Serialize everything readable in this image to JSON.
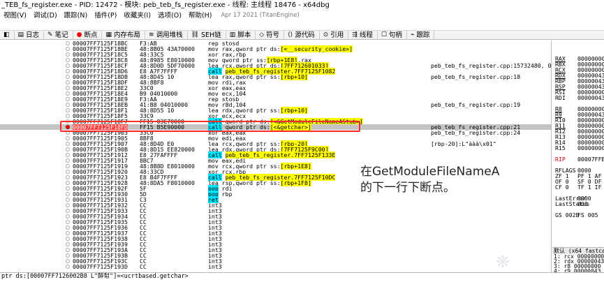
{
  "title": {
    "text": "_TEB_fs_register.exe - PID: 12472 - 模块: peb_teb_fs_register.exe - 线程: 主线程 18476 - x64dbg"
  },
  "menu": {
    "items": [
      "视图(V)",
      "调试(D)",
      "跟踪(N)",
      "插件(P)",
      "收藏夹(I)",
      "选项(O)",
      "帮助(H)"
    ],
    "date_info": "Apr 17 2021 (TitanEngine)"
  },
  "tabs": [
    {
      "label": "日志",
      "icon": "log-icon"
    },
    {
      "label": "笔记",
      "icon": "notes-icon"
    },
    {
      "label": "断点",
      "icon": "breakpoint-icon"
    },
    {
      "label": "内存布局",
      "icon": "memory-map-icon"
    },
    {
      "label": "调用堆栈",
      "icon": "call-stack-icon"
    },
    {
      "label": "SEH链",
      "icon": "seh-chain-icon"
    },
    {
      "label": "脚本",
      "icon": "script-icon"
    },
    {
      "label": "符号",
      "icon": "symbols-icon"
    },
    {
      "label": "源代码",
      "icon": "source-icon"
    },
    {
      "label": "引用",
      "icon": "references-icon"
    },
    {
      "label": "线程",
      "icon": "threads-icon"
    },
    {
      "label": "句柄",
      "icon": "handles-icon"
    },
    {
      "label": "跟踪",
      "icon": "trace-icon"
    }
  ],
  "disasm": {
    "rows": [
      {
        "addr": "00007FF7125F18BC",
        "bytes": "F3:AB",
        "instr": "rep stosd",
        "cmt": ""
      },
      {
        "addr": "00007FF7125F18BE",
        "bytes": "48:8B05 43A70000",
        "instr": "mov rax,qword ptr ds:[<__security_cookie>]",
        "cmt": ""
      },
      {
        "addr": "00007FF7125F18C5",
        "bytes": "48:33C5",
        "instr": "xor rax,rbp",
        "cmt": ""
      },
      {
        "addr": "00007FF7125F18C8",
        "bytes": "48:8985 E8010000",
        "instr": "mov qword ptr ss:[rbp+1E8],rax",
        "cmt": ""
      },
      {
        "addr": "00007FF7125F18CF",
        "bytes": "48:8D0D 5DF70000",
        "instr": "lea rcx,qword ptr ds:[7FF712601033]",
        "cmt": "peb_teb_fs_register.cpp:15732480, 0"
      },
      {
        "addr": "00007FF7125F18D6",
        "bytes": "E8 A7F7FFFF",
        "instr": "call peb_teb_fs_register.7FF7125F1082",
        "cmt": ""
      },
      {
        "addr": "00007FF7125F18DB",
        "bytes": "48:8D45 10",
        "instr": "lea rax,qword ptr ss:[rbp+10]",
        "cmt": "peb_teb_fs_register.cpp:18"
      },
      {
        "addr": "00007FF7125F18DF",
        "bytes": "48:8BF8",
        "instr": "mov rdi,rax",
        "cmt": ""
      },
      {
        "addr": "00007FF7125F18E2",
        "bytes": "33C0",
        "instr": "xor eax,eax",
        "cmt": ""
      },
      {
        "addr": "00007FF7125F18E4",
        "bytes": "B9 04010000",
        "instr": "mov ecx,104",
        "cmt": ""
      },
      {
        "addr": "00007FF7125F18E9",
        "bytes": "F3:AA",
        "instr": "rep stosb",
        "cmt": ""
      },
      {
        "addr": "00007FF7125F18EB",
        "bytes": "41:B8 04010000",
        "instr": "mov r8d,104",
        "cmt": "peb_teb_fs_register.cpp:19"
      },
      {
        "addr": "00007FF7125F18F1",
        "bytes": "48:8D55 10",
        "instr": "lea rdx,qword ptr ss:[rbp+10]",
        "cmt": ""
      },
      {
        "addr": "00007FF7125F18F5",
        "bytes": "33C9",
        "instr": "xor ecx,ecx",
        "cmt": ""
      },
      {
        "addr": "00007FF7125F18F7",
        "bytes": "FF15 03E70000",
        "instr": "call qword ptr ds:[<&GetModuleFileNameAStub>]",
        "cmt": ""
      },
      {
        "addr": "00007FF7125F18FD",
        "bytes": "FF15 B5E90000",
        "instr": "call qword ptr ds:[<&getchar>]",
        "cmt": "peb_teb_fs_register.cpp:21"
      },
      {
        "addr": "00007FF7125F1903",
        "bytes": "33C0",
        "instr": "xor eax,eax",
        "cmt": "peb_teb_fs_register.cpp:24"
      },
      {
        "addr": "00007FF7125F1905",
        "bytes": "8BF8",
        "instr": "mov edi,eax",
        "cmt": ""
      },
      {
        "addr": "00007FF7125F1907",
        "bytes": "48:8D4D E0",
        "instr": "lea rcx,qword ptr ss:[rbp-20]",
        "cmt": "[rbp-20]:L\"ààà\\x01\""
      },
      {
        "addr": "00007FF7125F190B",
        "bytes": "48:8D15 EE820000",
        "instr": "lea rdx,qword ptr ds:[7FF7125F9C00]",
        "cmt": ""
      },
      {
        "addr": "00007FF7125F1912",
        "bytes": "E8 27FAFFFF",
        "instr": "call peb_teb_fs_register.7FF7125F133E",
        "cmt": ""
      },
      {
        "addr": "00007FF7125F1917",
        "bytes": "8BC7",
        "instr": "mov eax,edi",
        "cmt": ""
      },
      {
        "addr": "00007FF7125F1919",
        "bytes": "48:8B8D E8010000",
        "instr": "mov rcx,qword ptr ss:[rbp+1E8]",
        "cmt": ""
      },
      {
        "addr": "00007FF7125F1920",
        "bytes": "48:33CD",
        "instr": "xor rcx,rbp",
        "cmt": ""
      },
      {
        "addr": "00007FF7125F1923",
        "bytes": "E8 B4F7FFFF",
        "instr": "call peb_teb_fs_register.7FF7125F10DC",
        "cmt": ""
      },
      {
        "addr": "00007FF7125F1928",
        "bytes": "48:8DA5 F8010000",
        "instr": "lea rsp,qword ptr ss:[rbp+1F8]",
        "cmt": ""
      },
      {
        "addr": "00007FF7125F192F",
        "bytes": "5F",
        "instr": "pop rdi",
        "cmt": ""
      },
      {
        "addr": "00007FF7125F1930",
        "bytes": "5D",
        "instr": "pop rbp",
        "cmt": ""
      },
      {
        "addr": "00007FF7125F1931",
        "bytes": "C3",
        "instr": "ret",
        "cmt": ""
      },
      {
        "addr": "00007FF7125F1932",
        "bytes": "CC",
        "instr": "int3",
        "cmt": ""
      },
      {
        "addr": "00007FF7125F1933",
        "bytes": "CC",
        "instr": "int3",
        "cmt": ""
      },
      {
        "addr": "00007FF7125F1934",
        "bytes": "CC",
        "instr": "int3",
        "cmt": ""
      },
      {
        "addr": "00007FF7125F1935",
        "bytes": "CC",
        "instr": "int3",
        "cmt": ""
      },
      {
        "addr": "00007FF7125F1936",
        "bytes": "CC",
        "instr": "int3",
        "cmt": ""
      },
      {
        "addr": "00007FF7125F1937",
        "bytes": "CC",
        "instr": "int3",
        "cmt": ""
      },
      {
        "addr": "00007FF7125F1938",
        "bytes": "CC",
        "instr": "int3",
        "cmt": ""
      },
      {
        "addr": "00007FF7125F1939",
        "bytes": "CC",
        "instr": "int3",
        "cmt": ""
      },
      {
        "addr": "00007FF7125F193A",
        "bytes": "CC",
        "instr": "int3",
        "cmt": ""
      },
      {
        "addr": "00007FF7125F193B",
        "bytes": "CC",
        "instr": "int3",
        "cmt": ""
      },
      {
        "addr": "00007FF7125F193C",
        "bytes": "CC",
        "instr": "int3",
        "cmt": ""
      },
      {
        "addr": "00007FF7125F193D",
        "bytes": "CC",
        "instr": "int3",
        "cmt": ""
      }
    ],
    "selected_index": 15
  },
  "annotation": {
    "line1": "在GetModuleFileNameA",
    "line2": "的下一行下断点。"
  },
  "registers": [
    {
      "name": "RAX",
      "value": "000000000",
      "style": "mod"
    },
    {
      "name": "RBX",
      "value": "000000000",
      "style": ""
    },
    {
      "name": "RCX",
      "value": "000000000",
      "style": "mod"
    },
    {
      "name": "RDX",
      "value": "000000433",
      "style": "mod"
    },
    {
      "name": "RBP",
      "value": "000000433",
      "style": ""
    },
    {
      "name": "RSP",
      "value": "000000433",
      "style": "mod"
    },
    {
      "name": "RSI",
      "value": "000000000",
      "style": ""
    },
    {
      "name": "RDI",
      "value": "000000433",
      "style": ""
    },
    {
      "name": "",
      "value": "",
      "style": ""
    },
    {
      "name": "R8",
      "value": "000000000",
      "style": "mod"
    },
    {
      "name": "R9",
      "value": "000000433",
      "style": "mod"
    },
    {
      "name": "R10",
      "value": "000000000",
      "style": ""
    },
    {
      "name": "R11",
      "value": "000000000",
      "style": "mod"
    },
    {
      "name": "R12",
      "value": "000000000",
      "style": ""
    },
    {
      "name": "R13",
      "value": "000000000",
      "style": ""
    },
    {
      "name": "R14",
      "value": "000000000",
      "style": ""
    },
    {
      "name": "R15",
      "value": "000000000",
      "style": ""
    },
    {
      "name": "",
      "value": "",
      "style": ""
    },
    {
      "name": "RIP",
      "value": "00007FFB",
      "style": "red"
    },
    {
      "name": "",
      "value": "",
      "style": ""
    },
    {
      "name": "RFLAGS",
      "value": "0000",
      "style": ""
    },
    {
      "name": "ZF 1",
      "value": "PF 1  AF",
      "style": ""
    },
    {
      "name": "OF 0",
      "value": "SF 0  DF",
      "style": ""
    },
    {
      "name": "CF 0",
      "value": "TF 1  IF",
      "style": ""
    },
    {
      "name": "",
      "value": "",
      "style": ""
    },
    {
      "name": "LastError",
      "value": "0000",
      "style": ""
    },
    {
      "name": "LastStatus",
      "value": "000",
      "style": ""
    },
    {
      "name": "",
      "value": "",
      "style": ""
    },
    {
      "name": "GS 002B",
      "value": "FS 005",
      "style": ""
    }
  ],
  "stack": {
    "header": "默认 (x64 fastca",
    "lines": [
      "1: rcx 00000000",
      "2: rdx 00000043",
      "3: r8 00000000",
      "4: r9 00000043",
      "5: [rsp+28] CCC"
    ]
  },
  "status": {
    "line1": "ptr ds:[00007FF7126002B8 L\"醉幇\"]=<ucrtbased.getchar>"
  }
}
